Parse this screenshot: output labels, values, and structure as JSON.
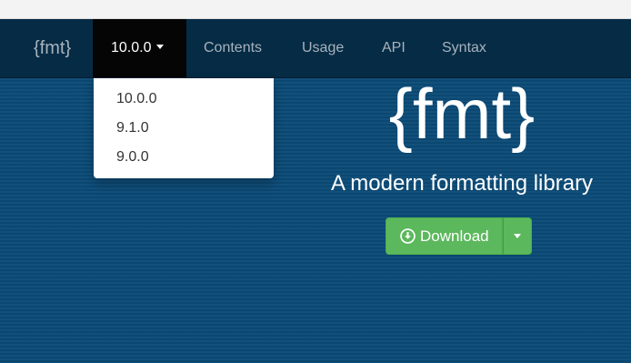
{
  "navbar": {
    "brand": "{fmt}",
    "version_selected": "10.0.0",
    "links": [
      "Contents",
      "Usage",
      "API",
      "Syntax"
    ]
  },
  "version_menu": {
    "items": [
      "10.0.0",
      "9.1.0",
      "9.0.0"
    ]
  },
  "hero": {
    "title": "{fmt}",
    "subtitle": "A modern formatting library",
    "download_label": "Download"
  },
  "colors": {
    "navbar_bg": "#062b45",
    "active_toggle_bg": "#050505",
    "hero_bg": "#0a4a76",
    "download_green": "#5cb85c",
    "nav_text": "#a7b3bd"
  },
  "icons": {
    "download": "download-circle-icon",
    "caret": "caret-down-icon"
  }
}
